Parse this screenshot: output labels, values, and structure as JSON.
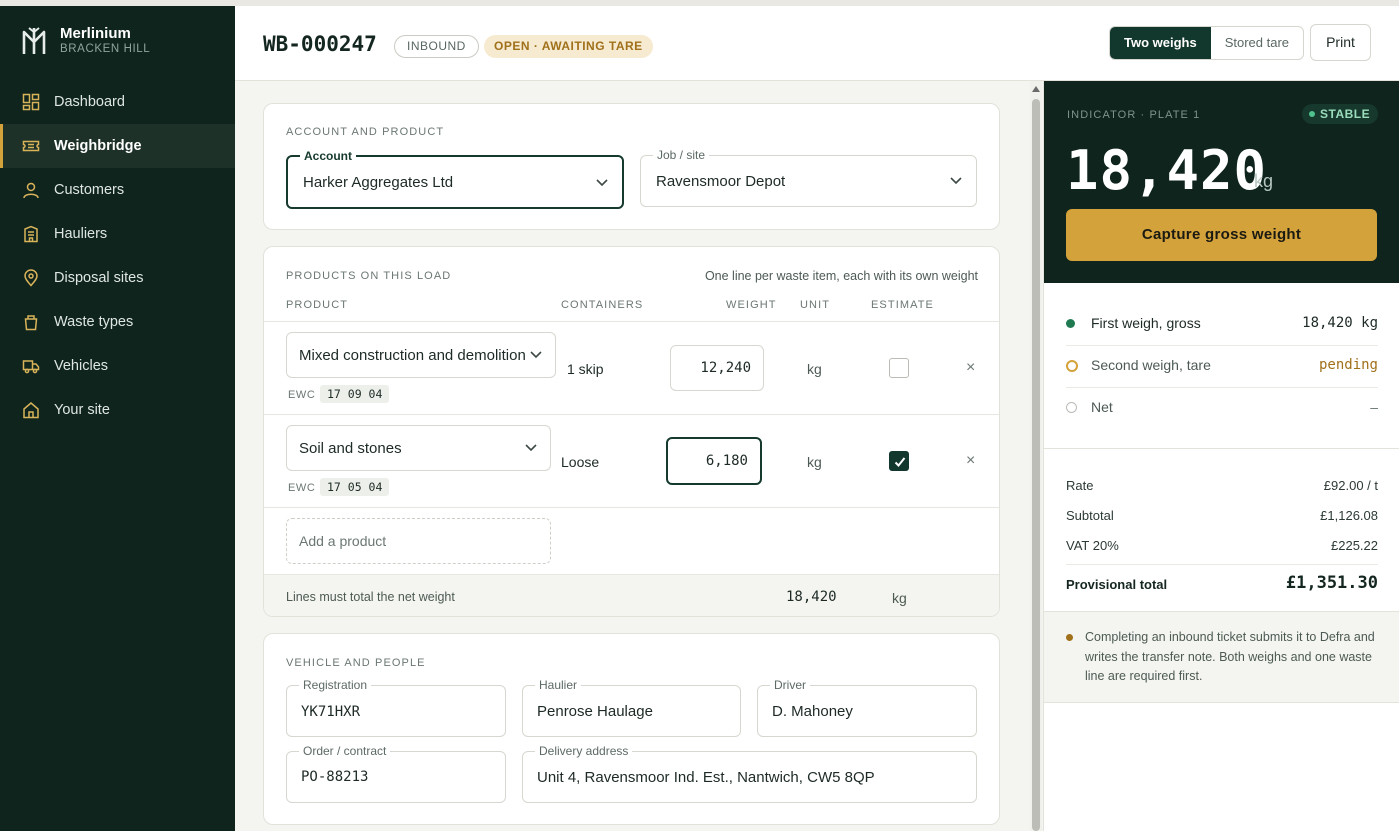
{
  "brand": {
    "name": "Merlinium",
    "site": "BRACKEN HILL"
  },
  "nav": [
    {
      "label": "Dashboard",
      "icon": "dashboard-icon"
    },
    {
      "label": "Weighbridge",
      "icon": "ticket-icon",
      "active": true
    },
    {
      "label": "Customers",
      "icon": "person-icon"
    },
    {
      "label": "Hauliers",
      "icon": "building-icon"
    },
    {
      "label": "Disposal sites",
      "icon": "map-pin-icon"
    },
    {
      "label": "Waste types",
      "icon": "bin-icon"
    },
    {
      "label": "Vehicles",
      "icon": "truck-icon"
    },
    {
      "label": "Your site",
      "icon": "home-icon"
    }
  ],
  "header": {
    "ticket_id": "WB-000247",
    "direction_tag": "INBOUND",
    "status_tag": "OPEN · AWAITING TARE",
    "mode_options": [
      "Two weighs",
      "Stored tare"
    ],
    "print_label": "Print"
  },
  "account": {
    "section_label": "ACCOUNT AND PRODUCT",
    "account_label": "Account",
    "account_value": "Harker Aggregates Ltd",
    "job_label": "Job / site",
    "job_value": "Ravensmoor Depot"
  },
  "products": {
    "section_label": "PRODUCTS ON THIS LOAD",
    "hint": "One line per waste item, each with its own weight",
    "columns": {
      "product": "PRODUCT",
      "containers": "CONTAINERS",
      "weight": "WEIGHT",
      "unit": "UNIT",
      "estimate": "ESTIMATE"
    },
    "ewc_label": "EWC",
    "lines": [
      {
        "product": "Mixed construction and demolition",
        "ewc": "17 09 04",
        "containers": "1 skip",
        "weight": "12,240",
        "unit": "kg",
        "estimate": false
      },
      {
        "product": "Soil and stones",
        "ewc": "17 05 04",
        "containers": "Loose",
        "weight": "6,180",
        "unit": "kg",
        "estimate": true
      }
    ],
    "add_placeholder": "Add a product",
    "total_note": "Lines must total the net weight",
    "total_weight": "18,420",
    "total_unit": "kg"
  },
  "vehicle": {
    "section_label": "VEHICLE AND PEOPLE",
    "registration_label": "Registration",
    "registration": "YK71HXR",
    "haulier_label": "Haulier",
    "haulier": "Penrose Haulage",
    "driver_label": "Driver",
    "driver": "D. Mahoney",
    "order_label": "Order / contract",
    "order": "PO-88213",
    "address_label": "Delivery address",
    "address": "Unit 4, Ravensmoor Ind. Est., Nantwich, CW5 8QP"
  },
  "indicator": {
    "label": "INDICATOR · PLATE 1",
    "status": "STABLE",
    "weight": "18,420",
    "unit": "kg",
    "capture_label": "Capture gross weight"
  },
  "weighs": [
    {
      "label": "First weigh, gross",
      "value": "18,420 kg",
      "state": "done"
    },
    {
      "label": "Second weigh, tare",
      "value": "pending",
      "state": "pending"
    },
    {
      "label": "Net",
      "value": "–",
      "state": "empty"
    }
  ],
  "pricing": {
    "rate_label": "Rate",
    "rate": "£92.00 / t",
    "subtotal_label": "Subtotal",
    "subtotal": "£1,126.08",
    "vat_label": "VAT 20%",
    "vat": "£225.22",
    "total_label": "Provisional total",
    "total": "£1,351.30"
  },
  "note": "Completing an inbound ticket submits it to Defra and writes the transfer note. Both weighs and one waste line are required first.",
  "colors": {
    "sidebar": "#0e241d",
    "accent": "#d4a23a",
    "primary": "#12372c",
    "success": "#1f7a52"
  }
}
